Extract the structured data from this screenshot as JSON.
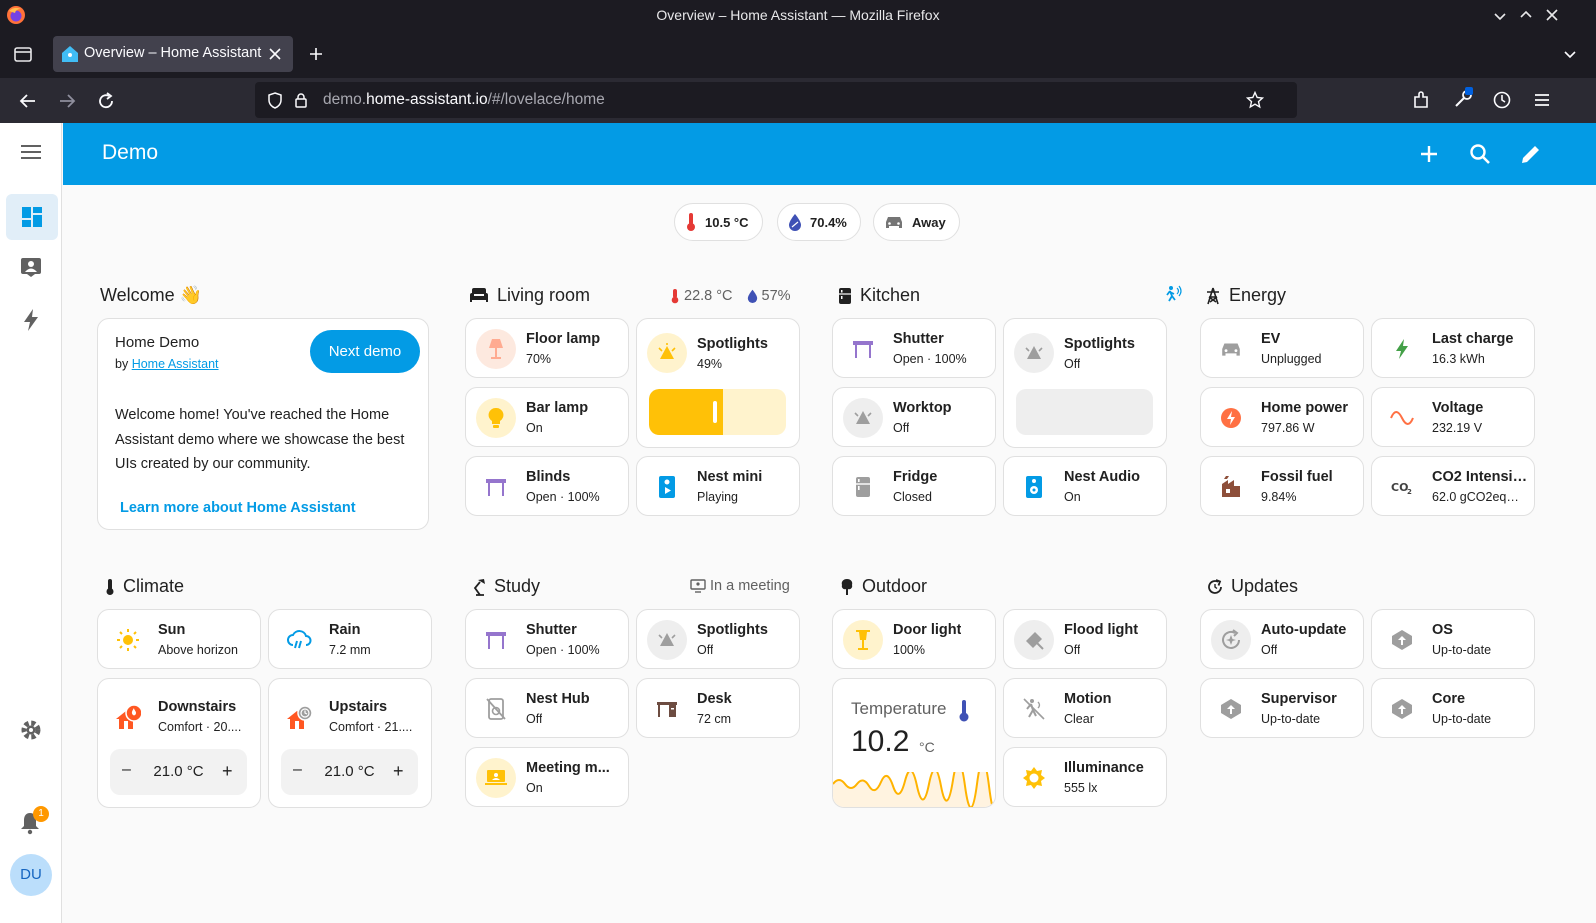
{
  "window": {
    "title": "Overview – Home Assistant — Mozilla Firefox"
  },
  "tab": {
    "title": "Overview – Home Assistant"
  },
  "url": {
    "prefix": "demo.",
    "domain": "home-assistant.io",
    "path": "/#/lovelace/home"
  },
  "header": {
    "title": "Demo"
  },
  "badges": {
    "temperature": "10.5 °C",
    "humidity": "70.4%",
    "presence": "Away"
  },
  "welcome": {
    "title": "Welcome 👋",
    "card_title": "Home Demo",
    "by": "by ",
    "by_link": "Home Assistant",
    "next_button": "Next demo",
    "body": "Welcome home! You've reached the Home Assistant demo where we showcase the best UIs created by our community.",
    "learn_more": "Learn more about Home Assistant"
  },
  "living_room": {
    "title": "Living room",
    "temperature": "22.8 °C",
    "humidity": "57%",
    "floor_lamp": {
      "name": "Floor lamp",
      "state": "70%"
    },
    "spotlights": {
      "name": "Spotlights",
      "state": "49%",
      "level": 0.49
    },
    "bar_lamp": {
      "name": "Bar lamp",
      "state": "On"
    },
    "blinds": {
      "name": "Blinds",
      "state": "Open · 100%"
    },
    "nest_mini": {
      "name": "Nest mini",
      "state": "Playing"
    }
  },
  "kitchen": {
    "title": "Kitchen",
    "shutter": {
      "name": "Shutter",
      "state": "Open · 100%"
    },
    "spotlights": {
      "name": "Spotlights",
      "state": "Off"
    },
    "worktop": {
      "name": "Worktop",
      "state": "Off"
    },
    "fridge": {
      "name": "Fridge",
      "state": "Closed"
    },
    "nest_audio": {
      "name": "Nest Audio",
      "state": "On"
    }
  },
  "energy": {
    "title": "Energy",
    "ev": {
      "name": "EV",
      "state": "Unplugged"
    },
    "last_charge": {
      "name": "Last charge",
      "state": "16.3 kWh"
    },
    "home_power": {
      "name": "Home power",
      "state": "797.86 W"
    },
    "voltage": {
      "name": "Voltage",
      "state": "232.19 V"
    },
    "fossil_fuel": {
      "name": "Fossil fuel",
      "state": "9.84%"
    },
    "co2": {
      "name": "CO2 Intensi…",
      "state": "62.0 gCO2eq…"
    }
  },
  "climate": {
    "title": "Climate",
    "sun": {
      "name": "Sun",
      "state": "Above horizon"
    },
    "rain": {
      "name": "Rain",
      "state": "7.2 mm"
    },
    "downstairs": {
      "name": "Downstairs",
      "state": "Comfort · 20....",
      "target": "21.0 °C"
    },
    "upstairs": {
      "name": "Upstairs",
      "state": "Comfort · 21....",
      "target": "21.0 °C"
    },
    "minus": "–",
    "plus": "+"
  },
  "study": {
    "title": "Study",
    "status": "In a meeting",
    "shutter": {
      "name": "Shutter",
      "state": "Open · 100%"
    },
    "spotlights": {
      "name": "Spotlights",
      "state": "Off"
    },
    "nest_hub": {
      "name": "Nest Hub",
      "state": "Off"
    },
    "desk": {
      "name": "Desk",
      "state": "72 cm"
    },
    "meeting": {
      "name": "Meeting m...",
      "state": "On"
    }
  },
  "outdoor": {
    "title": "Outdoor",
    "door_light": {
      "name": "Door light",
      "state": "100%"
    },
    "flood_light": {
      "name": "Flood light",
      "state": "Off"
    },
    "temperature": {
      "name": "Temperature",
      "value": "10.2",
      "unit": "°C"
    },
    "motion": {
      "name": "Motion",
      "state": "Clear"
    },
    "illuminance": {
      "name": "Illuminance",
      "state": "555 lx"
    }
  },
  "updates": {
    "title": "Updates",
    "auto_update": {
      "name": "Auto-update",
      "state": "Off"
    },
    "os": {
      "name": "OS",
      "state": "Up-to-date"
    },
    "supervisor": {
      "name": "Supervisor",
      "state": "Up-to-date"
    },
    "core": {
      "name": "Core",
      "state": "Up-to-date"
    }
  },
  "sidebar": {
    "notification_count": "1",
    "avatar": "DU"
  },
  "colors": {
    "header": "#039be5",
    "light_on": "#ffc107",
    "cover": "#9575cd",
    "media": "#039be5",
    "power": "#ff7043",
    "update": "#9e9e9e"
  }
}
